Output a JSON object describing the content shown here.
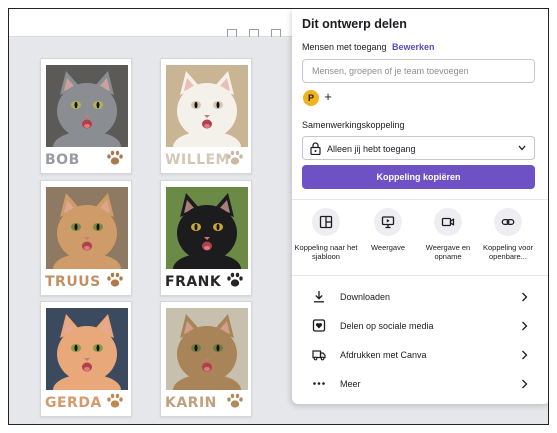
{
  "cats": [
    {
      "name": "BOB",
      "fur": "#8a8e93",
      "bg": "#5b5a56",
      "eye": "#b6b254",
      "name_color": "#9a9ba3",
      "paw_color": "#a97a4e"
    },
    {
      "name": "WILLEM",
      "fur": "#f4f1ea",
      "bg": "#c9b493",
      "eye": "#d4c8b4",
      "name_color": "#d4c8b4",
      "paw_color": "#c9b9a4"
    },
    {
      "name": "TRUUS",
      "fur": "#cf9c69",
      "bg": "#8e7a63",
      "eye": "#7a8a44",
      "name_color": "#c28f63",
      "paw_color": "#b07a48"
    },
    {
      "name": "FRANK",
      "fur": "#1c1c1f",
      "bg": "#6a8a46",
      "eye": "#c7a72d",
      "name_color": "#262626",
      "paw_color": "#262626"
    },
    {
      "name": "GERDA",
      "fur": "#e8a87a",
      "bg": "#3b4a5e",
      "eye": "#8c9b3e",
      "name_color": "#d59a6c",
      "paw_color": "#c0884e"
    },
    {
      "name": "KARIN",
      "fur": "#a88458",
      "bg": "#c7c0ae",
      "eye": "#6e7a3e",
      "name_color": "#c3a07c",
      "paw_color": "#b38a5c"
    }
  ],
  "share": {
    "title": "Dit ontwerp delen",
    "access_label": "Mensen met toegang",
    "edit_link": "Bewerken",
    "search_placeholder": "Mensen, groepen of je team toevoegen",
    "avatar_letter": "P",
    "add_symbol": "+",
    "collab_label": "Samenwerkingskoppeling",
    "access_value": "Alleen jij hebt toegang",
    "copy_button": "Koppeling kopiëren",
    "options": [
      {
        "label": "Koppeling naar het sjabloon",
        "icon": "template-icon"
      },
      {
        "label": "Weergave",
        "icon": "present-icon"
      },
      {
        "label": "Weergave en opname",
        "icon": "camera-icon"
      },
      {
        "label": "Koppeling voor openbare...",
        "icon": "link-icon"
      }
    ],
    "actions": [
      {
        "label": "Downloaden",
        "icon": "download-icon"
      },
      {
        "label": "Delen op sociale media",
        "icon": "heart-icon"
      },
      {
        "label": "Afdrukken met Canva",
        "icon": "truck-icon"
      },
      {
        "label": "Meer",
        "icon": "more-icon"
      }
    ]
  },
  "colors": {
    "accent": "#6e51c4",
    "link": "#5a4bc2",
    "avatar": "#f0b31b",
    "canvas_bg": "#e6e7eb"
  }
}
